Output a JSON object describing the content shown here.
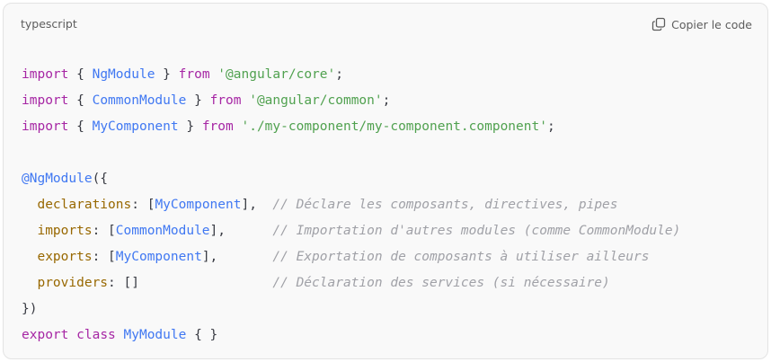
{
  "header": {
    "language": "typescript",
    "copy_label": "Copier le code"
  },
  "icons": {
    "copy": "copy-icon"
  },
  "colors": {
    "background": "#f9f9f9",
    "keyword": "#a626a4",
    "class_name": "#4078f2",
    "string": "#50a14f",
    "property": "#986801",
    "comment": "#a0a1a7",
    "text": "#383a42"
  },
  "code": {
    "import1": {
      "kw": "import",
      "open": " { ",
      "cls": "NgModule",
      "close": " } ",
      "from": "from",
      "sp": " ",
      "str": "'@angular/core'",
      "end": ";"
    },
    "import2": {
      "kw": "import",
      "open": " { ",
      "cls": "CommonModule",
      "close": " } ",
      "from": "from",
      "sp": " ",
      "str": "'@angular/common'",
      "end": ";"
    },
    "import3": {
      "kw": "import",
      "open": " { ",
      "cls": "MyComponent",
      "close": " } ",
      "from": "from",
      "sp": " ",
      "str": "'./my-component/my-component.component'",
      "end": ";"
    },
    "decorator": {
      "name": "@NgModule",
      "open": "({"
    },
    "declarations": {
      "indent": "  ",
      "prop": "declarations",
      "colon": ": [",
      "cls": "MyComponent",
      "close": "],",
      "pad": "  ",
      "comment": "// Déclare les composants, directives, pipes"
    },
    "imports": {
      "indent": "  ",
      "prop": "imports",
      "colon": ": [",
      "cls": "CommonModule",
      "close": "],",
      "pad": "      ",
      "comment": "// Importation d'autres modules (comme CommonModule)"
    },
    "exports": {
      "indent": "  ",
      "prop": "exports",
      "colon": ": [",
      "cls": "MyComponent",
      "close": "],",
      "pad": "       ",
      "comment": "// Exportation de composants à utiliser ailleurs"
    },
    "providers": {
      "indent": "  ",
      "prop": "providers",
      "colon": ": []",
      "pad": "                 ",
      "comment": "// Déclaration des services (si nécessaire)"
    },
    "decorator_close": "})",
    "class_line": {
      "kw1": "export",
      "sp1": " ",
      "kw2": "class",
      "sp2": " ",
      "cls": "MyModule",
      "body": " { }"
    }
  }
}
